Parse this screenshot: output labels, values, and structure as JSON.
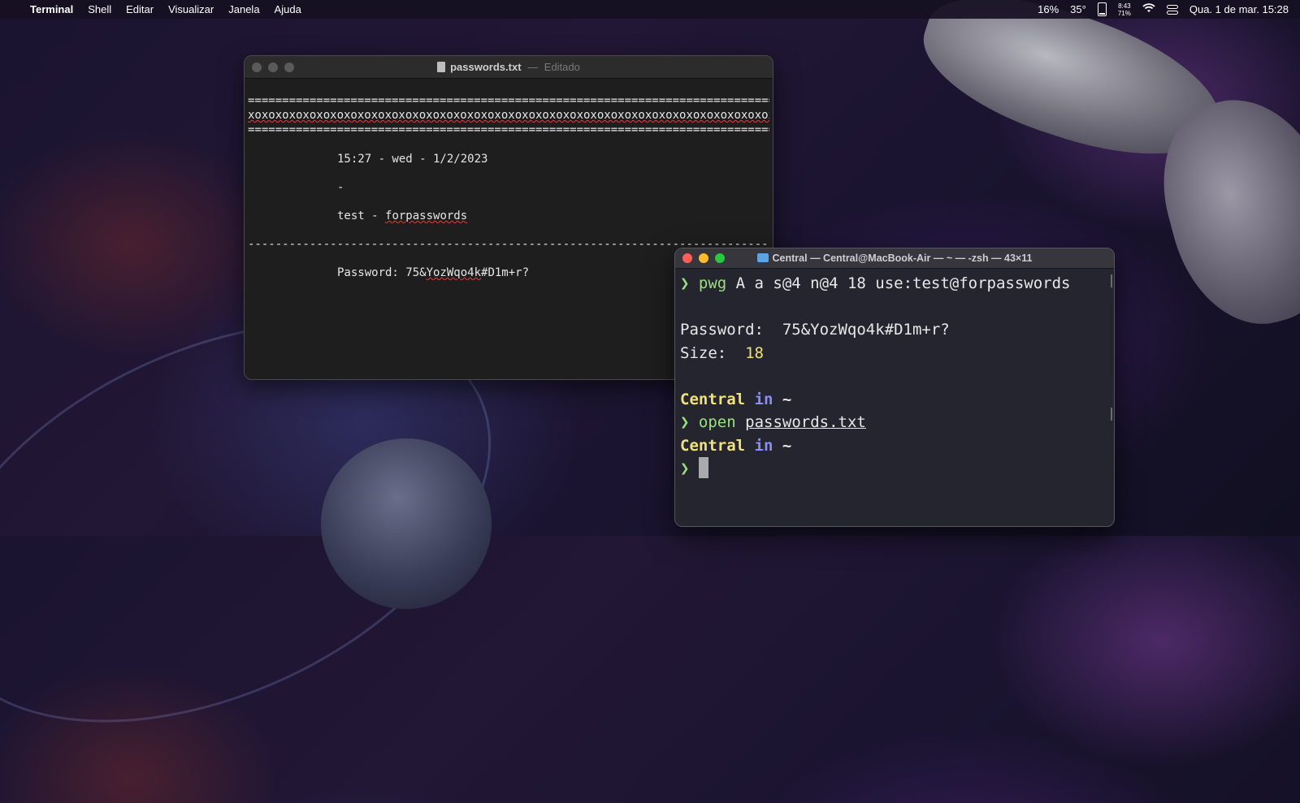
{
  "menubar": {
    "apple_icon": "",
    "app_name": "Terminal",
    "menus": [
      "Shell",
      "Editar",
      "Visualizar",
      "Janela",
      "Ajuda"
    ],
    "status": {
      "battery_percent": "16%",
      "temperature": "35°",
      "net_up": "8:43",
      "net_down": "71%",
      "datetime": "Qua. 1 de mar.  15:28"
    }
  },
  "textedit": {
    "title": "passwords.txt",
    "title_sep": "—",
    "subtitle": "Editado",
    "lines": {
      "eq1": "=================================================================================",
      "xo": "xoxoxoxoxoxoxoxoxoxoxoxoxoxoxoxoxoxoxoxoxoxoxoxoxoxoxoxoxoxoxoxoxoxoxoxoxoxoxoxoxox",
      "eq2": "=================================================================================",
      "date": "15:27 - wed - 1/2/2023",
      "dash": "-",
      "account_user": "test - ",
      "account_domain": "forpasswords",
      "divider": "---------------------------------------------------------------------------------",
      "pw_label": "Password: 75&",
      "pw_mid": "YozWqo4k",
      "pw_end": "#D1m+r?"
    }
  },
  "terminal": {
    "title": "Central — Central@MacBook-Air — ~ — -zsh — 43×11",
    "prompt_char": "❯",
    "cmd1_name": "pwg",
    "cmd1_args": " A a s@4 n@4 18 use:test@forpasswords",
    "out_password_label": "Password:  ",
    "out_password_value": "75&YozWqo4k#D1m+r?",
    "out_size_label": "Size:  ",
    "out_size_value": "18",
    "host": "Central",
    "in_word": " in ",
    "dir": "~",
    "cmd2_name": "open",
    "cmd2_arg": "passwords.txt"
  }
}
